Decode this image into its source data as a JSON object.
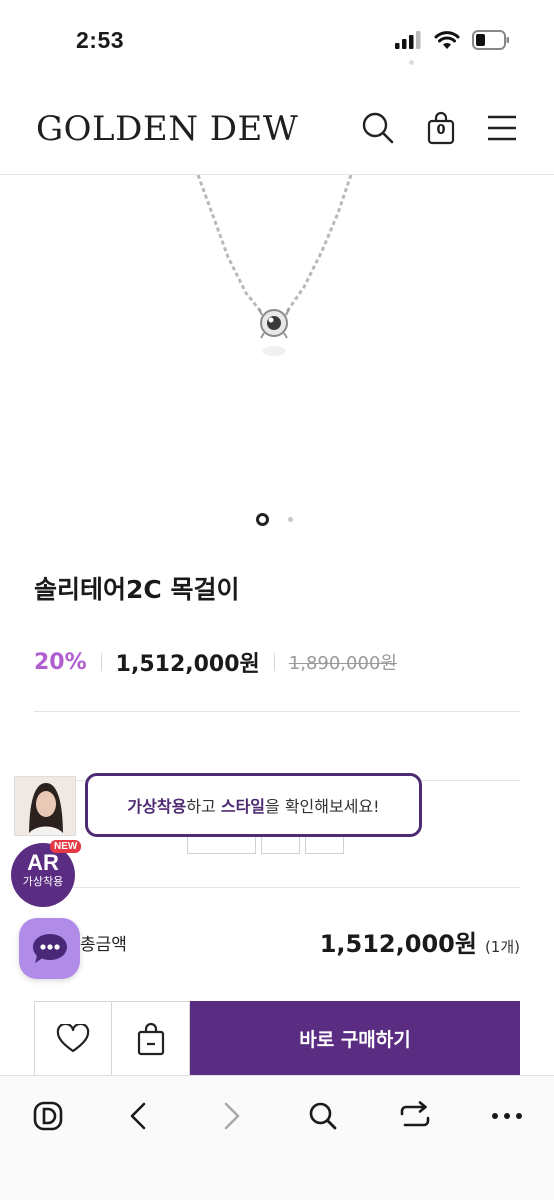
{
  "status_bar": {
    "time": "2:53"
  },
  "header": {
    "logo": "GOLDEN DEW",
    "cart_count": "0"
  },
  "product": {
    "name": "솔리테어2C 목걸이",
    "discount": "20%",
    "price": "1,512,000원",
    "original_price": "1,890,000원",
    "image_count": 2,
    "current_image": 1
  },
  "total": {
    "label": "총금액",
    "amount": "1,512,000원",
    "count": "(1개)"
  },
  "actions": {
    "buy_label": "바로 구매하기"
  },
  "ar": {
    "badge_title": "AR",
    "badge_sub": "가상착용",
    "new_tag": "NEW"
  },
  "tooltip": {
    "part1": "가상착용",
    "part2": "하고 ",
    "part3": "스타일",
    "part4": "을 확인해보세요!"
  },
  "colors": {
    "brand": "#5b2d82",
    "discount": "#b15fd0",
    "chat": "#b08ce8"
  }
}
